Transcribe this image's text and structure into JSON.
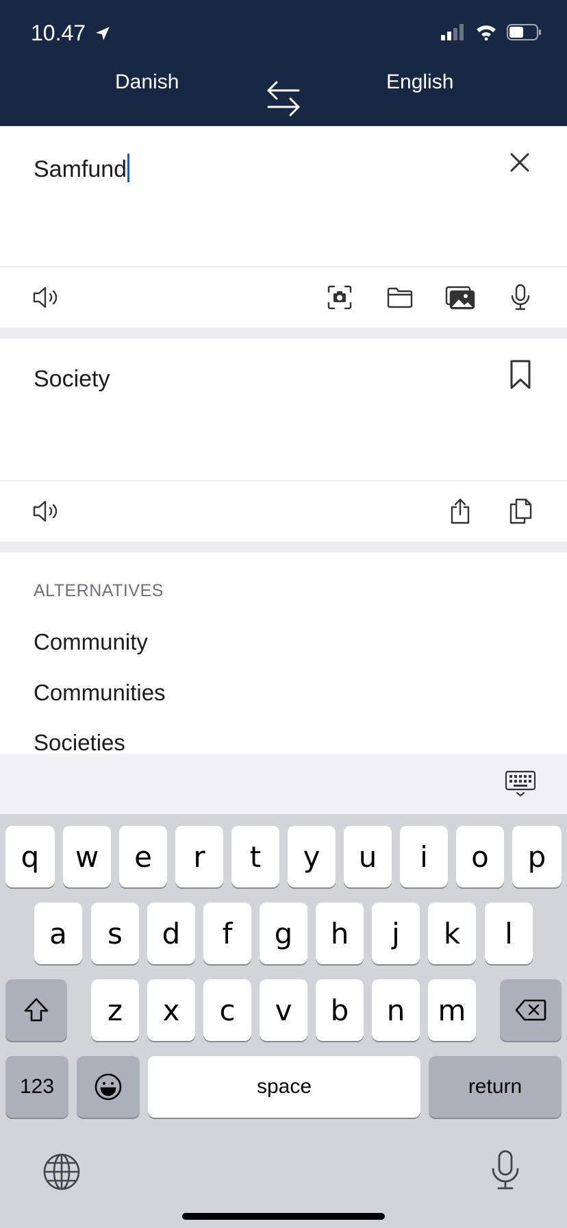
{
  "status_bar": {
    "time": "10.47",
    "icons": [
      "location-arrow-icon",
      "signal-icon",
      "wifi-icon",
      "battery-icon"
    ]
  },
  "header": {
    "source_language": "Danish",
    "target_language": "English",
    "swap_icon": "swap-arrows-icon"
  },
  "source": {
    "text": "Samfund",
    "clear_icon": "close-icon",
    "tools": [
      "speaker-icon",
      "camera-scan-icon",
      "folder-icon",
      "photos-icon",
      "microphone-icon"
    ]
  },
  "result": {
    "text": "Society",
    "bookmark_icon": "bookmark-icon",
    "tools": [
      "speaker-icon",
      "share-icon",
      "copy-icon"
    ]
  },
  "alternatives": {
    "title": "ALTERNATIVES",
    "items": [
      "Community",
      "Communities",
      "Societies"
    ]
  },
  "keyboard": {
    "row1": [
      "q",
      "w",
      "e",
      "r",
      "t",
      "y",
      "u",
      "i",
      "o",
      "p"
    ],
    "row2": [
      "a",
      "s",
      "d",
      "f",
      "g",
      "h",
      "j",
      "k",
      "l"
    ],
    "row3": [
      "z",
      "x",
      "c",
      "v",
      "b",
      "n",
      "m"
    ],
    "numbers_label": "123",
    "space_label": "space",
    "return_label": "return"
  },
  "colors": {
    "header_bg": "#182844",
    "caret": "#1f5fa8",
    "keyboard_bg": "#d2d4da"
  }
}
